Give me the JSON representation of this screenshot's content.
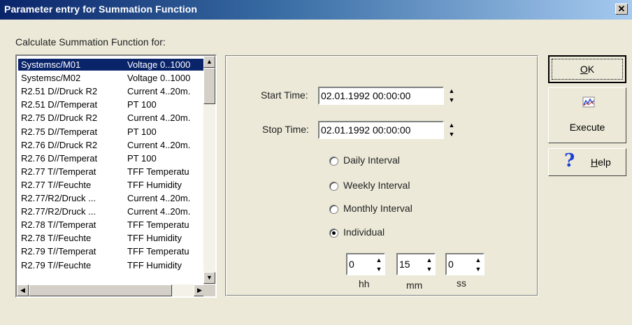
{
  "window": {
    "title": "Parameter entry for Summation Function",
    "close_glyph": "✕"
  },
  "caption": "Calculate Summation Function for:",
  "channels": [
    {
      "name": "Systemsc/M01",
      "type": "Voltage 0..1000",
      "selected": true
    },
    {
      "name": "Systemsc/M02",
      "type": "Voltage 0..1000"
    },
    {
      "name": "R2.51 D//Druck R2",
      "type": "Current 4..20m."
    },
    {
      "name": "R2.51 D//Temperat",
      "type": "PT 100"
    },
    {
      "name": "R2.75 D//Druck R2",
      "type": "Current 4..20m."
    },
    {
      "name": "R2.75 D//Temperat",
      "type": "PT 100"
    },
    {
      "name": "R2.76 D//Druck R2",
      "type": "Current 4..20m."
    },
    {
      "name": "R2.76 D//Temperat",
      "type": "PT 100"
    },
    {
      "name": "R2.77 T//Temperat",
      "type": "TFF Temperatu"
    },
    {
      "name": "R2.77 T//Feuchte",
      "type": "TFF Humidity"
    },
    {
      "name": "R2.77/R2/Druck ...",
      "type": "Current 4..20m."
    },
    {
      "name": "R2.77/R2/Druck ...",
      "type": "Current 4..20m."
    },
    {
      "name": "R2.78 T//Temperat",
      "type": "TFF Temperatu"
    },
    {
      "name": "R2.78 T//Feuchte",
      "type": "TFF Humidity"
    },
    {
      "name": "R2.79 T//Temperat",
      "type": "TFF Temperatu"
    },
    {
      "name": "R2.79 T//Feuchte",
      "type": "TFF Humidity"
    }
  ],
  "start_time": {
    "label": "Start Time:",
    "value": "02.01.1992 00:00:00"
  },
  "stop_time": {
    "label": "Stop Time:",
    "value": "02.01.1992 00:00:00"
  },
  "intervals": [
    {
      "label": "Daily Interval",
      "checked": false
    },
    {
      "label": "Weekly Interval",
      "checked": false
    },
    {
      "label": "Monthly Interval",
      "checked": false
    },
    {
      "label": "Individual",
      "checked": true
    }
  ],
  "individual": {
    "hh": {
      "value": "0",
      "label": "hh"
    },
    "mm": {
      "value": "15",
      "label": "mm"
    },
    "ss": {
      "value": "0",
      "label": "ss"
    }
  },
  "buttons": {
    "ok": {
      "label": "OK",
      "mnemonic": "O",
      "rest": "K"
    },
    "execute": {
      "label": "Execute",
      "icon": "chart-icon"
    },
    "help": {
      "label": "Help",
      "mnemonic": "H",
      "rest": "elp",
      "icon": "question-mark-icon"
    }
  },
  "spin_glyphs": {
    "up": "▲",
    "down": "▼",
    "left": "◀",
    "right": "▶"
  },
  "colors": {
    "selection": "#0a246a",
    "help_icon": "#1a3fd6"
  }
}
